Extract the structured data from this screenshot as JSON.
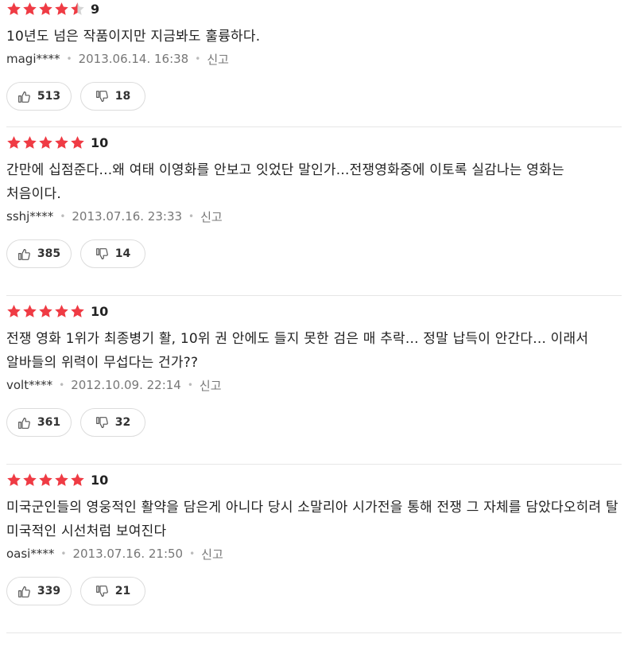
{
  "colors": {
    "star_on": "#ef3b44",
    "star_off": "#d5d5d5"
  },
  "reviews": [
    {
      "stars": 4.5,
      "score": "9",
      "text": "10년도 넘은 작품이지만 지금봐도 훌륭하다.",
      "author": "magi****",
      "date": "2013.06.14. 16:38",
      "report": "신고",
      "likes": "513",
      "dislikes": "18"
    },
    {
      "stars": 5,
      "score": "10",
      "text": "간만에 십점준다...왜 여태 이영화를 안보고 잇었단 말인가...전쟁영화중에 이토록 실감나는 영화는 처음이다.",
      "author": "sshj****",
      "date": "2013.07.16. 23:33",
      "report": "신고",
      "likes": "385",
      "dislikes": "14"
    },
    {
      "stars": 5,
      "score": "10",
      "text": "전쟁 영화 1위가 최종병기 활, 10위 권 안에도 들지 못한 검은 매 추락... 정말 납득이 안간다... 이래서 알바들의 위력이 무섭다는 건가??",
      "author": "volt****",
      "date": "2012.10.09. 22:14",
      "report": "신고",
      "likes": "361",
      "dislikes": "32"
    },
    {
      "stars": 5,
      "score": "10",
      "text": "미국군인들의 영웅적인 활약을 담은게 아니다 당시 소말리아 시가전을 통해 전쟁 그 자체를 담았다오히려 탈 미국적인 시선처럼 보여진다",
      "author": "oasi****",
      "date": "2013.07.16. 21:50",
      "report": "신고",
      "likes": "339",
      "dislikes": "21"
    }
  ]
}
